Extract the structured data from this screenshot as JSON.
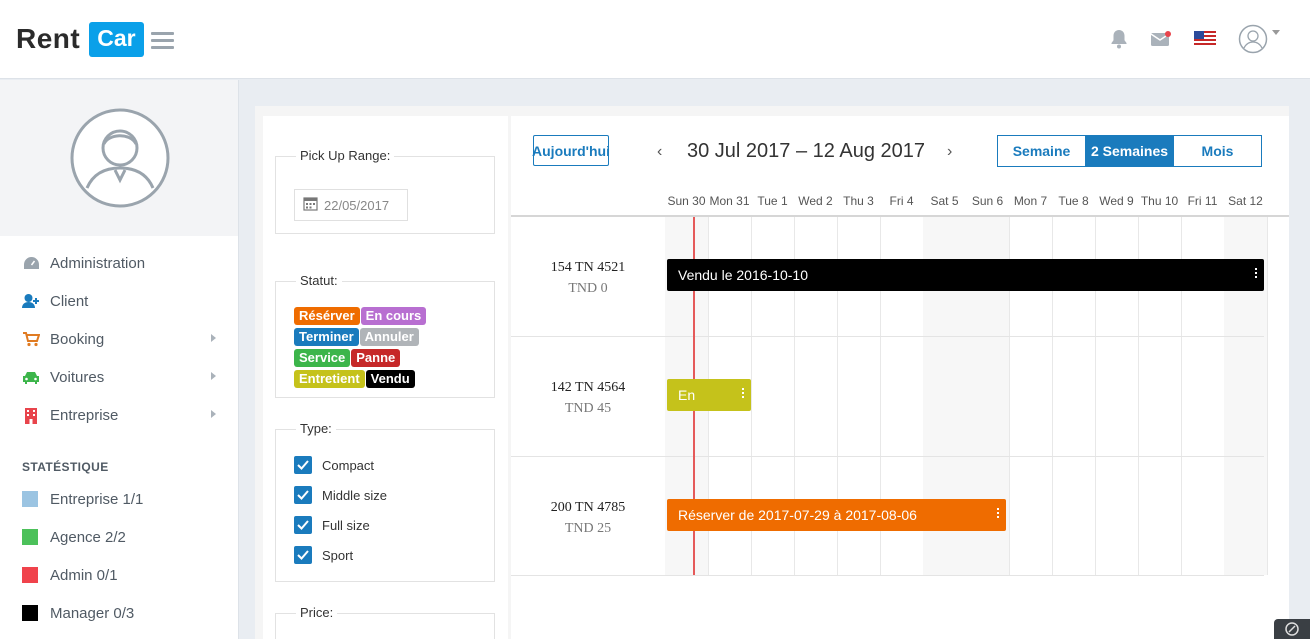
{
  "brand": {
    "rent": "Rent",
    "car": "Car"
  },
  "topbar": {
    "icons": [
      "bell-icon",
      "mail-icon",
      "us-flag-icon",
      "user-avatar-icon"
    ]
  },
  "sidebar": {
    "menu": [
      {
        "label": "Administration",
        "icon": "dashboard-icon",
        "color": "#9aa4ad",
        "has_arrow": false
      },
      {
        "label": "Client",
        "icon": "user-plus-icon",
        "color": "#1a7bbd",
        "has_arrow": false
      },
      {
        "label": "Booking",
        "icon": "cart-icon",
        "color": "#e07b22",
        "has_arrow": true
      },
      {
        "label": "Voitures",
        "icon": "car-icon",
        "color": "#3cb54a",
        "has_arrow": true
      },
      {
        "label": "Entreprise",
        "icon": "building-icon",
        "color": "#e8444c",
        "has_arrow": true
      }
    ],
    "stats_title": "STATÉSTIQUE",
    "stats": [
      {
        "label": "Entreprise 1/1",
        "color": "#9bc4e2"
      },
      {
        "label": "Agence 2/2",
        "color": "#4cc15a"
      },
      {
        "label": "Admin 0/1",
        "color": "#f0434c"
      },
      {
        "label": "Manager 0/3",
        "color": "#000000"
      }
    ]
  },
  "filters": {
    "pickup": {
      "legend": "Pick Up Range:",
      "date": "22/05/2017"
    },
    "statut": {
      "legend": "Statut:",
      "tags": [
        {
          "label": "Résérver",
          "color": "#ef6c00"
        },
        {
          "label": "En cours",
          "color": "#b86fd1"
        },
        {
          "label": "Terminer",
          "color": "#1a7bbd"
        },
        {
          "label": "Annuler",
          "color": "#b0b4b8"
        },
        {
          "label": "Service",
          "color": "#3cb54a"
        },
        {
          "label": "Panne",
          "color": "#c62828"
        },
        {
          "label": "Entretient",
          "color": "#c5c21b"
        },
        {
          "label": "Vendu",
          "color": "#000000"
        }
      ]
    },
    "type": {
      "legend": "Type:",
      "options": [
        {
          "label": "Compact",
          "checked": true
        },
        {
          "label": "Middle size",
          "checked": true
        },
        {
          "label": "Full size",
          "checked": true
        },
        {
          "label": "Sport",
          "checked": true
        }
      ]
    },
    "price": {
      "legend": "Price:"
    }
  },
  "calendar": {
    "today_label": "Aujourd'hui",
    "range_title": "30 Jul 2017 – 12 Aug 2017",
    "views": [
      {
        "label": "Semaine",
        "active": false
      },
      {
        "label": "2 Semaines",
        "active": true
      },
      {
        "label": "Mois",
        "active": false
      }
    ],
    "days": [
      "Sun 30",
      "Mon 31",
      "Tue 1",
      "Wed 2",
      "Thu 3",
      "Fri 4",
      "Sat 5",
      "Sun 6",
      "Mon 7",
      "Tue 8",
      "Wed 9",
      "Thu 10",
      "Fri 11",
      "Sat 12"
    ],
    "resources": [
      {
        "name": "154 TN 4521",
        "price": "TND 0"
      },
      {
        "name": "142 TN 4564",
        "price": "TND 45"
      },
      {
        "name": "200 TN 4785",
        "price": "TND 25"
      }
    ],
    "events": [
      {
        "row": 0,
        "start_day": 0,
        "span_days": 14,
        "label": "Vendu le 2016-10-10",
        "color": "#000000"
      },
      {
        "row": 1,
        "start_day": 0,
        "span_days": 2,
        "label": "En",
        "color": "#c5c21b"
      },
      {
        "row": 2,
        "start_day": 0,
        "span_days": 8,
        "label": "Réserver de 2017-07-29 à 2017-08-06",
        "color": "#ef6c00"
      }
    ]
  }
}
